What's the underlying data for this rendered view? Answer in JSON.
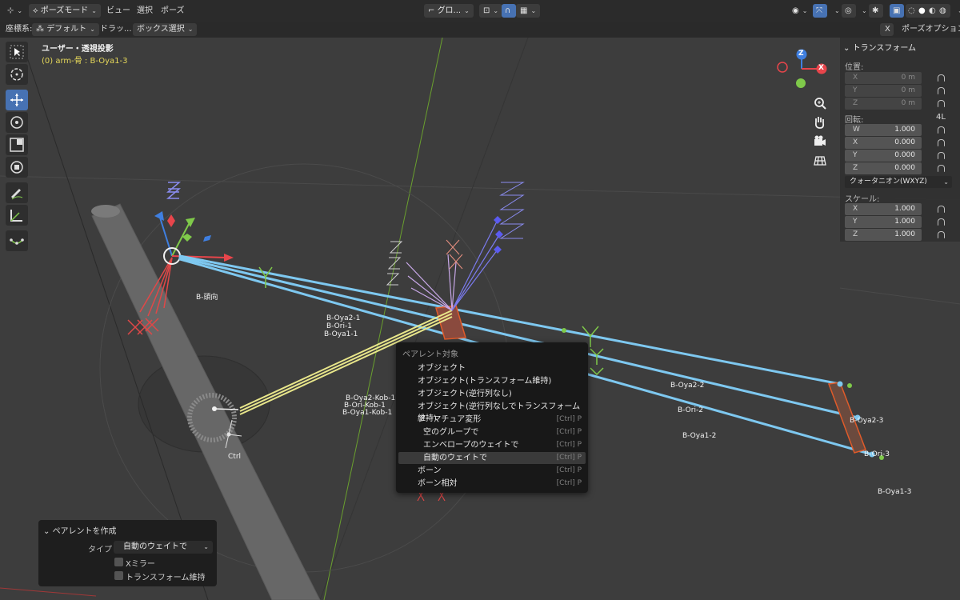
{
  "header": {
    "mode": "ポーズモード",
    "menus": [
      "ビュー",
      "選択",
      "ポーズ"
    ],
    "transform_orientation": "グロ...",
    "pose_options": "ポーズオプション"
  },
  "toolsettings": {
    "coord_label": "座標系:",
    "coord_value": "デフォルト",
    "drag_label": "ドラッ...",
    "drag_value": "ボックス選択"
  },
  "viewport": {
    "view_name": "ユーザー・透視投影",
    "active_object": "(0) arm-骨 : B-Oya1-3"
  },
  "gizmo": {
    "z": "Z",
    "x": "X"
  },
  "npanel": {
    "title": "トランスフォーム",
    "location_label": "位置:",
    "location": [
      {
        "axis": "X",
        "value": "0 m"
      },
      {
        "axis": "Y",
        "value": "0 m"
      },
      {
        "axis": "Z",
        "value": "0 m"
      }
    ],
    "rotation_label": "回転:",
    "rotation_mode_short": "4L",
    "rotation": [
      {
        "axis": "W",
        "value": "1.000"
      },
      {
        "axis": "X",
        "value": "0.000"
      },
      {
        "axis": "Y",
        "value": "0.000"
      },
      {
        "axis": "Z",
        "value": "0.000"
      }
    ],
    "rotation_mode": "クォータニオン(WXYZ)",
    "scale_label": "スケール:",
    "scale": [
      {
        "axis": "X",
        "value": "1.000"
      },
      {
        "axis": "Y",
        "value": "1.000"
      },
      {
        "axis": "Z",
        "value": "1.000"
      }
    ]
  },
  "context_menu": {
    "title": "ペアレント対象",
    "items": [
      {
        "label": "オブジェクト",
        "shortcut": ""
      },
      {
        "label": "オブジェクト(トランスフォーム維持)",
        "shortcut": ""
      },
      {
        "label": "オブジェクト(逆行列なし)",
        "shortcut": ""
      },
      {
        "label": "オブジェクト(逆行列なしでトランスフォーム維持)",
        "shortcut": ""
      },
      {
        "label": "アーマチュア変形",
        "shortcut": "[Ctrl] P"
      },
      {
        "label": "空のグループで",
        "shortcut": "[Ctrl] P"
      },
      {
        "label": "エンベロープのウェイトで",
        "shortcut": "[Ctrl] P"
      },
      {
        "label": "自動のウェイトで",
        "shortcut": "[Ctrl] P"
      },
      {
        "label": "ボーン",
        "shortcut": "[Ctrl] P"
      },
      {
        "label": "ボーン相対",
        "shortcut": "[Ctrl] P"
      }
    ]
  },
  "redo_panel": {
    "title": "ペアレントを作成",
    "type_label": "タイプ",
    "type_value": "自動のウェイトで",
    "x_mirror": "Xミラー",
    "keep_transform": "トランスフォーム維持"
  },
  "bone_labels": {
    "b_head": "B-頭向",
    "oya2_1": "B-Oya2-1",
    "ori_1": "B-Ori-1",
    "oya1_1": "B-Oya1-1",
    "oya2_2": "B-Oya2-2",
    "ori_2": "B-Ori-2",
    "oya1_2": "B-Oya1-2",
    "oya2_3": "B-Oya2-3",
    "ori_3": "B-Ori-3",
    "oya1_3": "B-Oya1-3",
    "oya2_kob_1": "B-Oya2-Kob-1",
    "ori_kob_1": "B-Ori-Kob-1",
    "oya1_kob_1": "B-Oya1-Kob-1",
    "ctrl": "Ctrl"
  },
  "colors": {
    "accent": "#4772b3",
    "bone_selected": "#7ec8f0",
    "bone_yellow": "#e8e68a",
    "axis_x": "#e8454b",
    "axis_y": "#7fc94a",
    "axis_z": "#3f7fe0"
  }
}
